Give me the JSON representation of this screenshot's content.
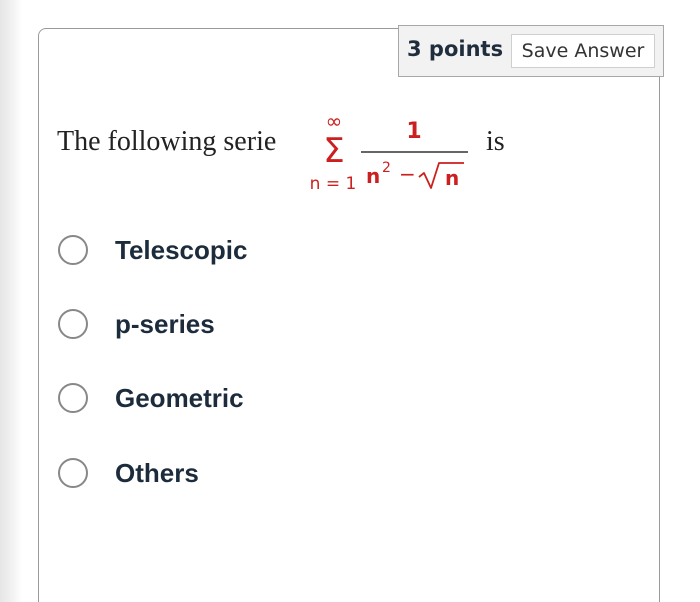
{
  "header": {
    "points": "3 points",
    "save_label": "Save Answer"
  },
  "question": {
    "prefix": "The following  serie",
    "suffix": "is",
    "formula": {
      "sum_upper": "∞",
      "sum_symbol": "Σ",
      "sum_lower": "n = 1",
      "numerator": "1",
      "denominator_base": "n",
      "denominator_exponent": "2",
      "denominator_minus": "−",
      "denominator_root_arg": "n",
      "color": "#cc1f1f"
    }
  },
  "options": [
    {
      "label": "Telescopic"
    },
    {
      "label": "p-series"
    },
    {
      "label": "Geometric"
    },
    {
      "label": "Others"
    }
  ],
  "colors": {
    "option_text": "#1c2c3c",
    "radio_border": "#888888",
    "header_background": "#f2f2f2"
  }
}
